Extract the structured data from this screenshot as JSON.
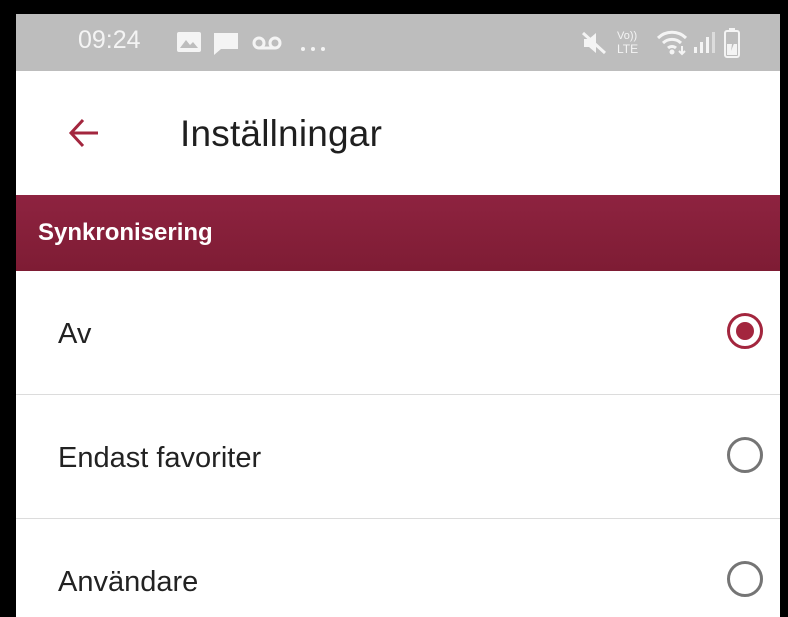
{
  "status_bar": {
    "time": "09:24",
    "left_icons": [
      "image-icon",
      "message-icon",
      "voicemail-icon",
      "more-dots-icon"
    ],
    "right_icons": [
      "mute-icon",
      "volte-icon",
      "wifi-icon",
      "signal-icon",
      "battery-icon"
    ],
    "volte_label": "LTE"
  },
  "app_bar": {
    "title": "Inställningar",
    "back_icon": "arrow-back-icon",
    "accent_color": "#a3263e"
  },
  "section": {
    "label": "Synkronisering",
    "color": "#8a2139"
  },
  "options": [
    {
      "label": "Av",
      "selected": true
    },
    {
      "label": "Endast favoriter",
      "selected": false
    },
    {
      "label": "Användare",
      "selected": false
    }
  ]
}
